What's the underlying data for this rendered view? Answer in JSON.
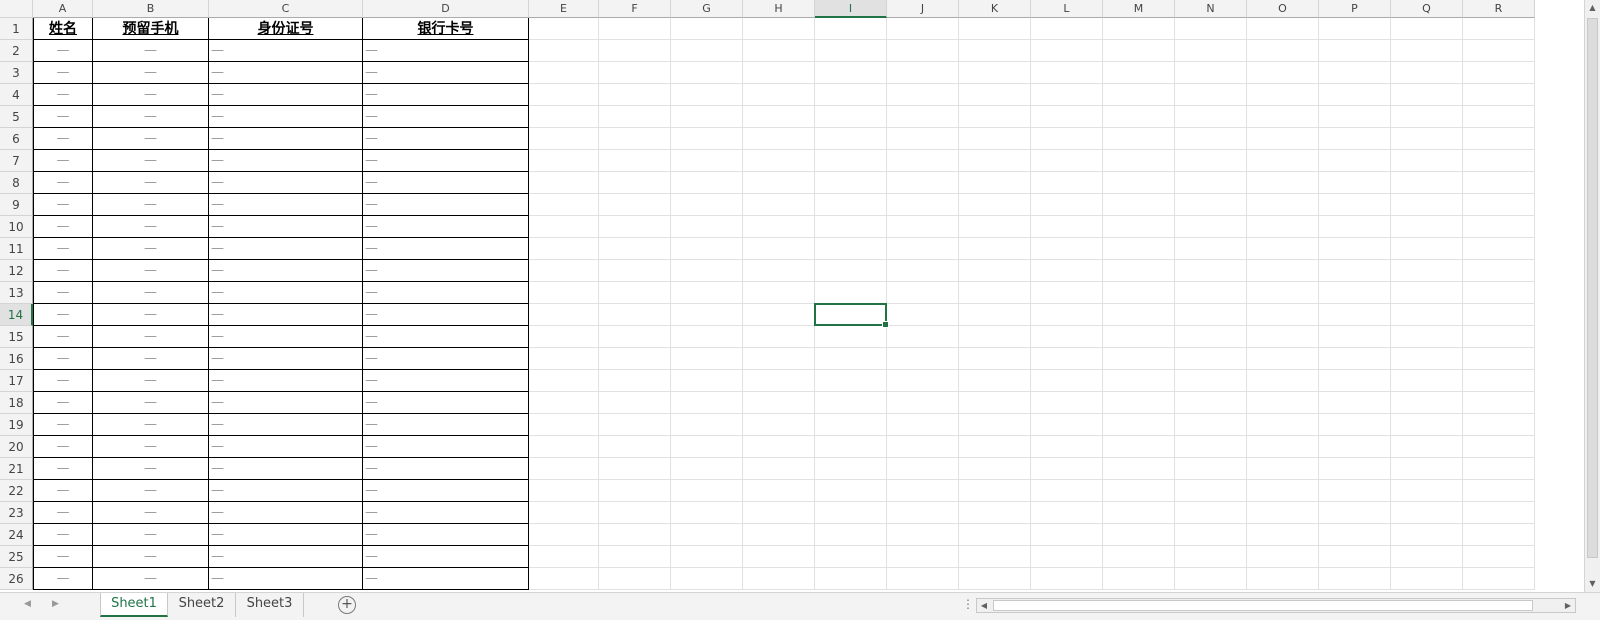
{
  "sheet": {
    "columns": [
      "A",
      "B",
      "C",
      "D",
      "E",
      "F",
      "G",
      "H",
      "I",
      "J",
      "K",
      "L",
      "M",
      "N",
      "O",
      "P",
      "Q",
      "R"
    ],
    "active_column": "I",
    "active_row": 14,
    "row_count": 26,
    "header_row": [
      "姓名",
      "预留手机",
      "身份证号",
      "银行卡号"
    ],
    "records_omitted": 25,
    "placeholders": [
      "—",
      "—",
      "—",
      "—"
    ]
  },
  "tabs": [
    "Sheet1",
    "Sheet2",
    "Sheet3"
  ],
  "active_tab": "Sheet1",
  "add_sheet_label": "+",
  "accent_color": "#217346"
}
